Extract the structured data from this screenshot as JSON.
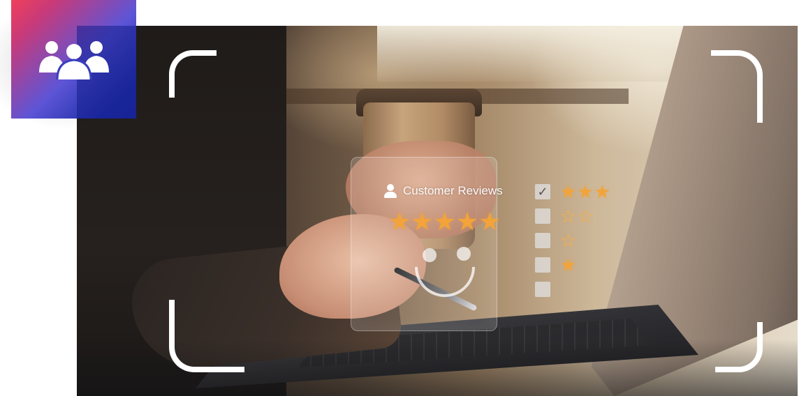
{
  "image": {
    "type": "stock-photo-with-overlay",
    "overlay_card": {
      "title": "Customer Reviews",
      "icon": "person-icon",
      "rating_stars": "★★★★★",
      "expression_icon": "smile-face-icon"
    },
    "checklist": [
      {
        "checked": true,
        "mark": "✓",
        "stars": "★★★"
      },
      {
        "checked": false,
        "mark": "",
        "stars": "☆☆"
      },
      {
        "checked": false,
        "mark": "",
        "stars": "☆"
      },
      {
        "checked": false,
        "mark": "",
        "stars": "★"
      },
      {
        "checked": false,
        "mark": "",
        "stars": ""
      }
    ],
    "badge": {
      "icon": "group-users-icon",
      "colors": {
        "start": "#f0405b",
        "mid": "#5d55d6",
        "end": "#1a2aa0"
      }
    },
    "accent_colors": {
      "stars": "#f2a33a",
      "brackets": "#ffffff"
    }
  }
}
